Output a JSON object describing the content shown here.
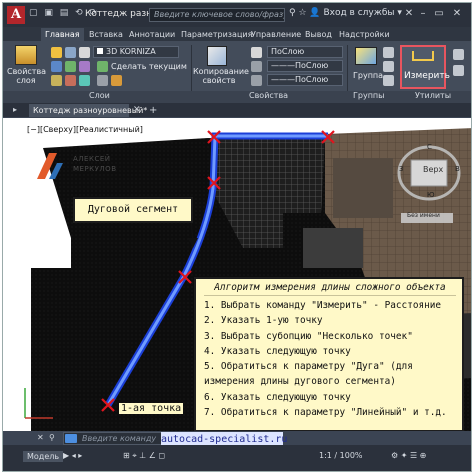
{
  "app": {
    "logo_letter": "A",
    "doc_title": "Коттедж разно...",
    "search_placeholder": "Введите ключевое слово/фразу",
    "signin": "Вход в службы",
    "quick_access": "▢ ▣ ▤ ⟲ ⟳",
    "win_controls": [
      "–",
      "▭",
      "✕"
    ]
  },
  "tabs": [
    {
      "label": "Главная"
    },
    {
      "label": "Вставка"
    },
    {
      "label": "Аннотации"
    },
    {
      "label": "Параметризация"
    },
    {
      "label": "Управление"
    },
    {
      "label": "Вывод"
    },
    {
      "label": "Надстройки"
    }
  ],
  "ribbon": {
    "layer_props_label": "Свойства\nслоя",
    "layer_dropdown": "3D KORNIZA",
    "make_current": "Сделать текущим",
    "copy_props_label": "Копирование\nсвойств",
    "bylayer1": "ПоСлою",
    "bylayer2": "———ПоСлою",
    "bylayer3": "———ПоСлою",
    "group_label": "Группа",
    "measure_label": "Измерить",
    "group_titles": {
      "layers": "Слои",
      "properties": "Свойства",
      "groups": "Группы",
      "utilities": "Утилиты"
    },
    "dropdown_arrow": "▾"
  },
  "file_tab": "Коттедж разноуровневый*",
  "viewport_label": "[−][Сверху][Реалистичный]",
  "watermark": {
    "line1": "АЛЕКСЕЙ",
    "line2": "МЕРКУЛОВ"
  },
  "viewcube": {
    "face": "Верх",
    "north": "С",
    "east": "В",
    "south": "Ю",
    "west": "З",
    "ucs": "Без имени"
  },
  "callout_arc": "Дуговой сегмент",
  "algorithm": {
    "title": "Алгоритм измерения длины сложного объекта",
    "steps": [
      "1. Выбрать команду \"Измерить\" - Расстояние",
      "2. Указать 1-ую точку",
      "3. Выбрать субопцию \"Несколько точек\"",
      "4. Указать следующую точку",
      "5. Обратиться к параметру \"Дуга\" (для",
      "измерения длины дугового сегмента)",
      "6. Указать следующую точку",
      "7. Обратиться к параметру \"Линейный\" и т.д."
    ]
  },
  "point1_label": "1-ая точка",
  "command_placeholder": "Введите команду",
  "site": "autocad-specialist.ru",
  "status": {
    "model_tab": "Модель",
    "scale": "1:1 / 100%",
    "left_tools": "▶ ◂ ▸",
    "icons": "⊞ ⌖ ⊥ ∠ ◻",
    "right_tools": "⚙ ✦ ☰ ⊕"
  },
  "colors": {
    "accent_red": "#e8555f",
    "arc_blue": "#2f6cff",
    "callout_bg": "#fff9c8"
  }
}
